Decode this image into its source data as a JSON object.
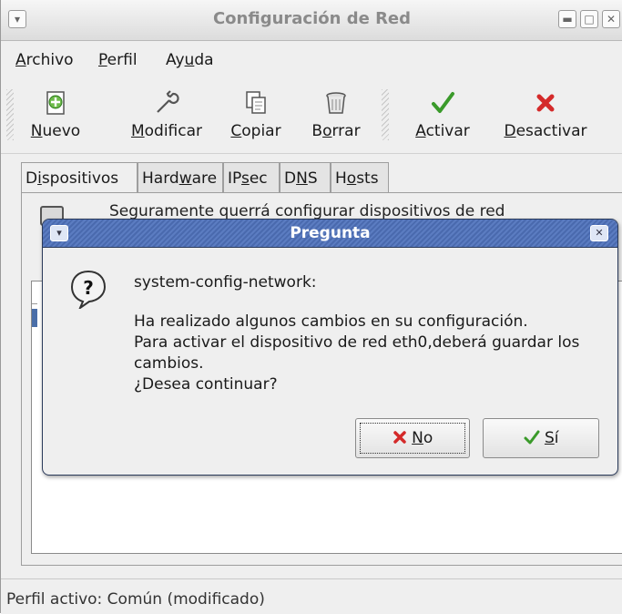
{
  "window": {
    "title": "Configuración de Red",
    "buttons": [
      "chevron-down",
      "minimize",
      "maximize",
      "close"
    ]
  },
  "menubar": {
    "archivo": {
      "mn": "A",
      "rest": "rchivo"
    },
    "perfil": {
      "mn": "P",
      "rest": "erfil"
    },
    "ayuda": {
      "pre": "Ay",
      "mn": "u",
      "rest": "da"
    }
  },
  "toolbar": {
    "nuevo": {
      "pre": "",
      "mn": "N",
      "rest": "uevo",
      "icon": "new-icon"
    },
    "modificar": {
      "pre": "",
      "mn": "M",
      "rest": "odificar",
      "icon": "wrench-icon"
    },
    "copiar": {
      "pre": "",
      "mn": "C",
      "rest": "opiar",
      "icon": "copy-icon"
    },
    "borrar": {
      "pre": "B",
      "mn": "o",
      "rest": "rrar",
      "icon": "trash-icon"
    },
    "activar": {
      "pre": "",
      "mn": "A",
      "rest": "ctivar",
      "icon": "check-icon"
    },
    "desactivar": {
      "pre": "",
      "mn": "D",
      "rest": "esactivar",
      "icon": "x-icon"
    }
  },
  "tabs": {
    "dispositivos": {
      "pre": "D",
      "mn": "i",
      "rest": "spositivos"
    },
    "hardware": {
      "pre": "Hard",
      "mn": "w",
      "rest": "are"
    },
    "ipsec": {
      "pre": "IP",
      "mn": "s",
      "rest": "ec"
    },
    "dns": {
      "pre": "D",
      "mn": "N",
      "rest": "S"
    },
    "hosts": {
      "pre": "H",
      "mn": "o",
      "rest": "sts"
    }
  },
  "panel": {
    "hint": "Seguramente querrá configurar dispositivos de red"
  },
  "dialog": {
    "title": "Pregunta",
    "line1": "system-config-network:",
    "line2": "Ha realizado algunos cambios en su configuración.",
    "line3": "Para activar el dispositivo de red eth0,deberá guardar los",
    "line4": "cambios.",
    "line5": "¿Desea continuar?",
    "no": {
      "mn": "N",
      "rest": "o"
    },
    "si": {
      "mn": "S",
      "rest": "í"
    }
  },
  "status": "Perfil activo: Común (modificado)",
  "colors": {
    "dialog_title": "#5b7cc1",
    "selection": "#4a6ea8",
    "check_green": "#3a9a2a",
    "x_red": "#d42a2a"
  }
}
